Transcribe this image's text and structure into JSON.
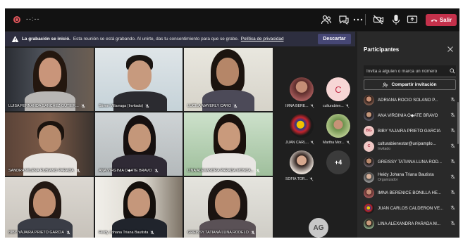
{
  "toolbar": {
    "timer": "--:--",
    "leave_label": "Salir"
  },
  "banner": {
    "bold": "La grabación se inició.",
    "message": "Esta reunión se está grabando. Al unirte, das tu consentimiento para que se grabe.",
    "link": "Política de privacidad",
    "dismiss": "Descartar"
  },
  "tiles": [
    {
      "name": "LUISA FERNANDA SANCHEZ GUTIER..."
    },
    {
      "name": "Stiven Villarraga (Invitado)"
    },
    {
      "name": "LUCILA MAYERLY CARO"
    },
    {
      "name": "SANDRA MILENA RUBIANO PARADA"
    },
    {
      "name": "ANA VIRGINIA O◆ATE BRAVO"
    },
    {
      "name": "LINA ALEXANDRA PARADA MONCA..."
    },
    {
      "name": "BIBY YAJAIRA PRIETO GARCIA"
    },
    {
      "name": "Heidy Johana Triana Bautista"
    },
    {
      "name": "GREISSY TATIANA LUNA RODELO"
    }
  ],
  "strip": {
    "avatars": [
      {
        "label": "IMNA BERE..."
      },
      {
        "label": "culturabien...",
        "initial": "C"
      },
      {
        "label": "JUAN CARL..."
      },
      {
        "label": "Martha Mor..."
      },
      {
        "label": "SOFIA TOR..."
      },
      {
        "more": "+4"
      }
    ],
    "self_initials": "AG"
  },
  "panel": {
    "title": "Participantes",
    "invite_placeholder": "Invita a alguien o marca un número",
    "share_label": "Compartir invitación",
    "participants": [
      {
        "name": "ADRIANA ROCIO SOLANO P..."
      },
      {
        "name": "ANA VIRGINIA O◆ATE BRAVO"
      },
      {
        "name": "BIBY YAJAIRA PRIETO GARCIA",
        "initials": "BG"
      },
      {
        "name": "culturabienestar@unipamplo...",
        "sub": "Invitado",
        "initials": "C"
      },
      {
        "name": "GREISSY TATIANA LUNA ROD..."
      },
      {
        "name": "Heidy Johana Triana Bautista",
        "sub": "Organizador"
      },
      {
        "name": "IMNA BERENICE BONILLA HE..."
      },
      {
        "name": "JUAN CARLOS CALDERON VE..."
      },
      {
        "name": "LINA ALEXANDRA PARADA M..."
      }
    ]
  },
  "colors": {
    "leave": "#c4314b",
    "banner": "#2d2e3f",
    "dismiss": "#464775",
    "panel": "#292929"
  }
}
